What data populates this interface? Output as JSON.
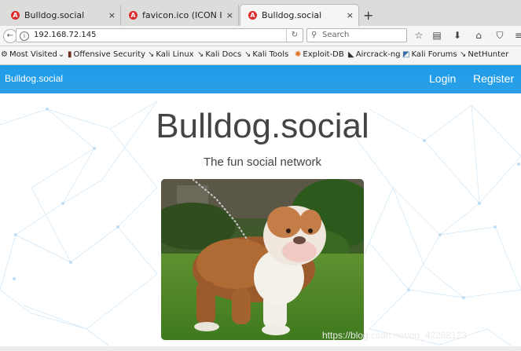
{
  "browser": {
    "tabs": [
      {
        "title": "Bulldog.social",
        "favicon": "angular-icon",
        "active": false
      },
      {
        "title": "favicon.ico (ICON Ima...",
        "favicon": "angular-icon",
        "active": false
      },
      {
        "title": "Bulldog.social",
        "favicon": "angular-icon",
        "active": true
      }
    ],
    "close_glyph": "×",
    "new_tab_glyph": "+",
    "url": "192.168.72.145",
    "search_placeholder": "Search",
    "bookmarks": [
      {
        "label": "Most Visited",
        "icon": "gear-icon"
      },
      {
        "label": "Offensive Security",
        "icon": "offsec-icon"
      },
      {
        "label": "Kali Linux",
        "icon": "kali-dragon-icon"
      },
      {
        "label": "Kali Docs",
        "icon": "kali-dragon-icon"
      },
      {
        "label": "Kali Tools",
        "icon": "kali-dragon-icon"
      },
      {
        "label": "Exploit-DB",
        "icon": "exploitdb-icon"
      },
      {
        "label": "Aircrack-ng",
        "icon": "aircrack-icon"
      },
      {
        "label": "Kali Forums",
        "icon": "kali-forums-icon"
      },
      {
        "label": "NetHunter",
        "icon": "kali-dragon-icon"
      }
    ]
  },
  "site": {
    "brand": "Bulldog.social",
    "nav": {
      "login": "Login",
      "register": "Register"
    },
    "title": "Bulldog.social",
    "subtitle": "The fun social network",
    "header_color": "#2196f3",
    "watermark": "https://blog.csdn.net/qq_42288123"
  }
}
